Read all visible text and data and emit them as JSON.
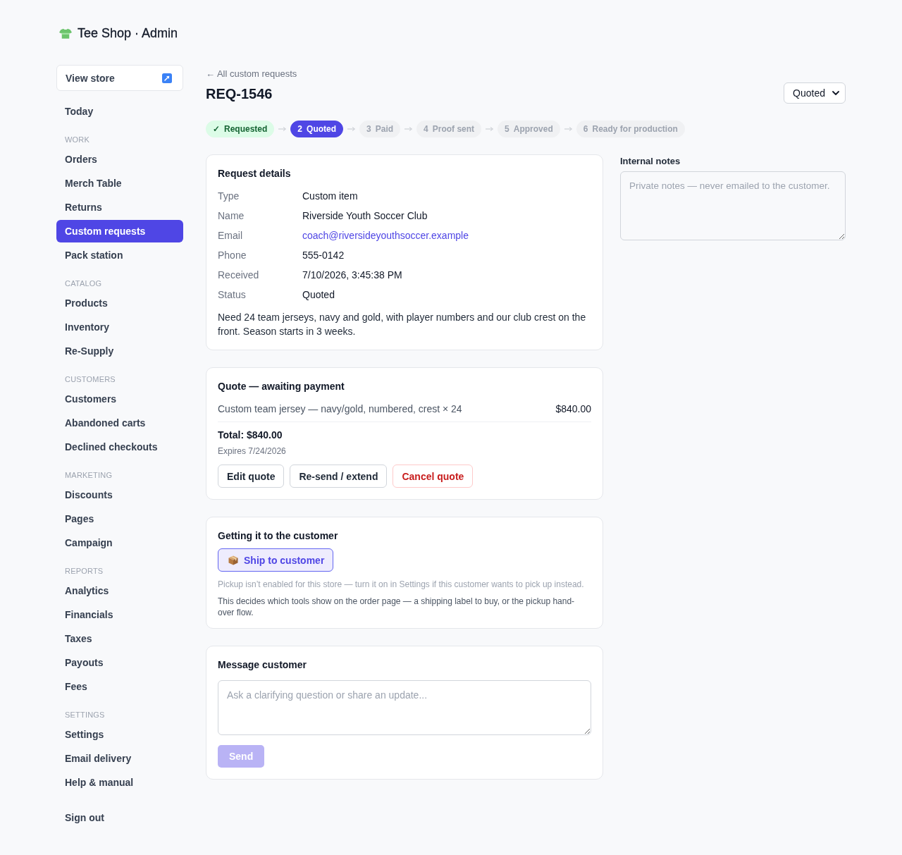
{
  "brand": {
    "title": "Tee Shop · Admin"
  },
  "sidebar": {
    "view_store": "View store",
    "top_items": [
      {
        "label": "Today",
        "selected": false
      }
    ],
    "sections": [
      {
        "title": "WORK",
        "items": [
          {
            "label": "Orders",
            "selected": false
          },
          {
            "label": "Merch Table",
            "selected": false
          },
          {
            "label": "Returns",
            "selected": false
          },
          {
            "label": "Custom requests",
            "selected": true
          },
          {
            "label": "Pack station",
            "selected": false
          }
        ]
      },
      {
        "title": "CATALOG",
        "items": [
          {
            "label": "Products",
            "selected": false
          },
          {
            "label": "Inventory",
            "selected": false
          },
          {
            "label": "Re-Supply",
            "selected": false
          }
        ]
      },
      {
        "title": "CUSTOMERS",
        "items": [
          {
            "label": "Customers",
            "selected": false
          },
          {
            "label": "Abandoned carts",
            "selected": false
          },
          {
            "label": "Declined checkouts",
            "selected": false
          }
        ]
      },
      {
        "title": "MARKETING",
        "items": [
          {
            "label": "Discounts",
            "selected": false
          },
          {
            "label": "Pages",
            "selected": false
          },
          {
            "label": "Campaign",
            "selected": false
          }
        ]
      },
      {
        "title": "REPORTS",
        "items": [
          {
            "label": "Analytics",
            "selected": false
          },
          {
            "label": "Financials",
            "selected": false
          },
          {
            "label": "Taxes",
            "selected": false
          },
          {
            "label": "Payouts",
            "selected": false
          },
          {
            "label": "Fees",
            "selected": false
          }
        ]
      },
      {
        "title": "SETTINGS",
        "items": [
          {
            "label": "Settings",
            "selected": false
          },
          {
            "label": "Email delivery",
            "selected": false
          },
          {
            "label": "Help & manual",
            "selected": false
          }
        ]
      }
    ],
    "sign_out": "Sign out"
  },
  "header": {
    "back_link": "← All custom requests",
    "title": "REQ-1546",
    "status_select": {
      "value": "Quoted"
    }
  },
  "steps": [
    {
      "marker": "✓",
      "label": "Requested",
      "done": true,
      "selected": false
    },
    {
      "marker": "2",
      "label": "Quoted",
      "done": false,
      "selected": true
    },
    {
      "marker": "3",
      "label": "Paid",
      "done": false,
      "selected": false
    },
    {
      "marker": "4",
      "label": "Proof sent",
      "done": false,
      "selected": false
    },
    {
      "marker": "5",
      "label": "Approved",
      "done": false,
      "selected": false
    },
    {
      "marker": "6",
      "label": "Ready for production",
      "done": false,
      "selected": false
    }
  ],
  "request_details": {
    "title": "Request details",
    "rows": [
      {
        "label": "Type",
        "value": "Custom item",
        "kind": "text"
      },
      {
        "label": "Name",
        "value": "Riverside Youth Soccer Club",
        "kind": "text"
      },
      {
        "label": "Email",
        "value": "coach@riversideyouthsoccer.example",
        "kind": "link"
      },
      {
        "label": "Phone",
        "value": "555-0142",
        "kind": "text"
      },
      {
        "label": "Received",
        "value": "7/10/2026, 3:45:38 PM",
        "kind": "text"
      },
      {
        "label": "Status",
        "value": "Quoted",
        "kind": "text"
      }
    ],
    "description": "Need 24 team jerseys, navy and gold, with player numbers and our club crest on the front. Season starts in 3 weeks."
  },
  "quote": {
    "title": "Quote — awaiting payment",
    "line_items": [
      {
        "description": "Custom team jersey — navy/gold, numbered, crest × 24",
        "amount": "$840.00"
      }
    ],
    "total": "Total: $840.00",
    "expires": "Expires 7/24/2026",
    "actions": [
      {
        "label": "Edit quote",
        "kind": "default"
      },
      {
        "label": "Re-send / extend",
        "kind": "default"
      },
      {
        "label": "Cancel quote",
        "kind": "danger"
      }
    ]
  },
  "fulfillment": {
    "title": "Getting it to the customer",
    "options": [
      {
        "label": "Ship to customer",
        "selected": true
      }
    ],
    "note": "Pickup isn’t enabled for this store — turn it on in Settings if this customer wants to pick up instead.",
    "help": "This decides which tools show on the order page — a shipping label to buy, or the pickup hand-over flow."
  },
  "message": {
    "title": "Message customer",
    "placeholder": "Ask a clarifying question or share an update...",
    "send": {
      "label": "Send",
      "disabled": true
    }
  },
  "internal_notes": {
    "label": "Internal notes",
    "placeholder": "Private notes — never emailed to the customer."
  }
}
